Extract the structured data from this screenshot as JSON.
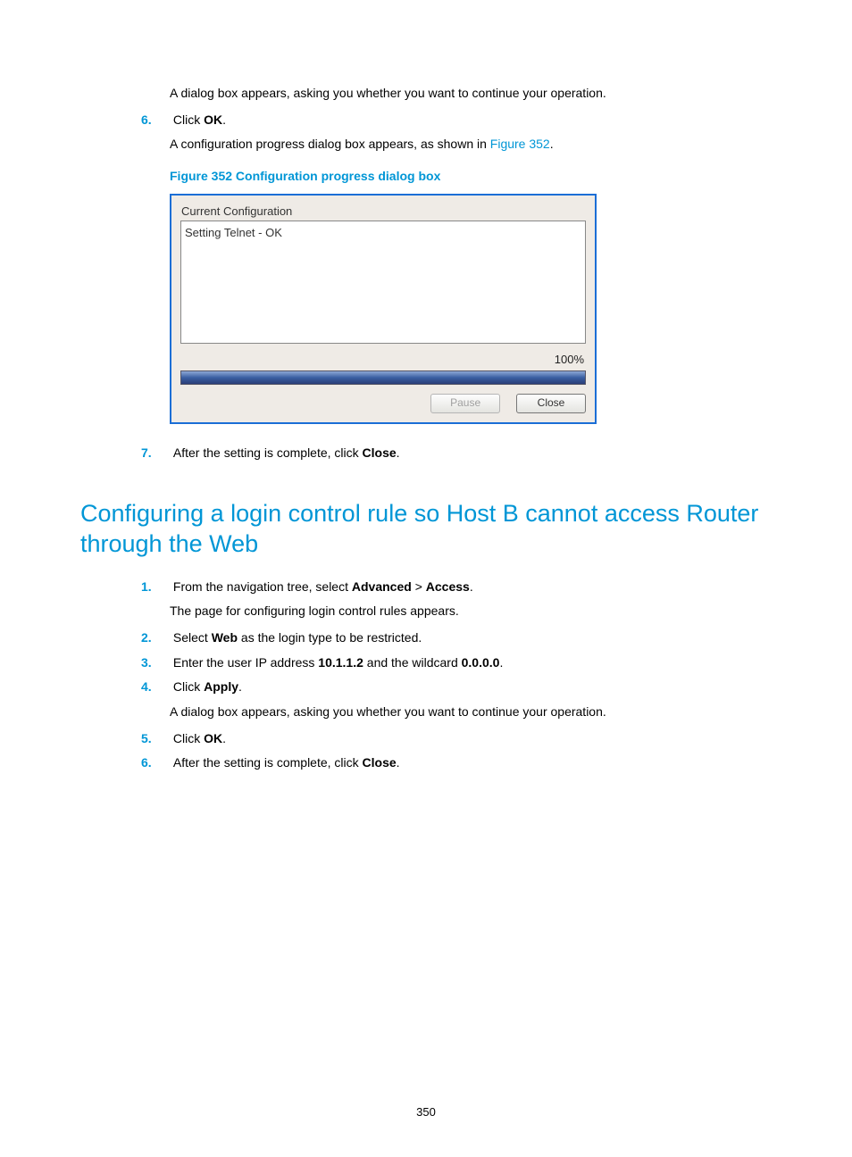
{
  "pageNumber": "350",
  "stepsA": {
    "pre_sub": "A dialog box appears, asking you whether you want to continue your operation.",
    "s6": {
      "num": "6.",
      "text_before": "Click ",
      "bold": "OK",
      "text_after": "."
    },
    "s6_sub_pre": "A configuration progress dialog box appears, as shown in ",
    "s6_sub_link": "Figure 352",
    "s6_sub_post": ".",
    "s7": {
      "num": "7.",
      "text_before": "After the setting is complete, click ",
      "bold": "Close",
      "text_after": "."
    }
  },
  "figure": {
    "caption": "Figure 352 Configuration progress dialog box",
    "title": "Current Configuration",
    "log_line1": "Setting Telnet - OK",
    "percent": "100%",
    "btn_pause": "Pause",
    "btn_close": "Close"
  },
  "heading2": "Configuring a login control rule so Host B cannot access Router through the Web",
  "stepsB": {
    "s1": {
      "num": "1.",
      "pre": "From the navigation tree, select ",
      "b1": "Advanced",
      "mid": " > ",
      "b2": "Access",
      "post": "."
    },
    "s1_sub": "The page for configuring login control rules appears.",
    "s2": {
      "num": "2.",
      "pre": "Select ",
      "b1": "Web",
      "post": " as the login type to be restricted."
    },
    "s3": {
      "num": "3.",
      "pre": "Enter the user IP address ",
      "b1": "10.1.1.2",
      "mid": " and the wildcard ",
      "b2": "0.0.0.0",
      "post": "."
    },
    "s4": {
      "num": "4.",
      "pre": "Click ",
      "b1": "Apply",
      "post": "."
    },
    "s4_sub": "A dialog box appears, asking you whether you want to continue your operation.",
    "s5": {
      "num": "5.",
      "pre": "Click ",
      "b1": "OK",
      "post": "."
    },
    "s6": {
      "num": "6.",
      "pre": "After the setting is complete, click ",
      "b1": "Close",
      "post": "."
    }
  }
}
